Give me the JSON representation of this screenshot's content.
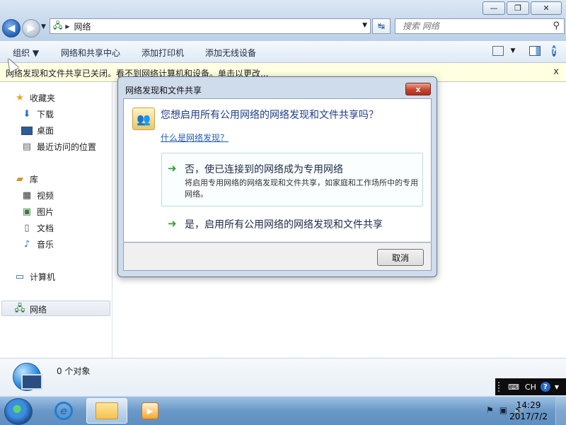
{
  "window": {
    "controls": {
      "minimize": "—",
      "restore": "❐",
      "close": "✕"
    }
  },
  "addressbar": {
    "crumb": "网络",
    "icon": "network-icon"
  },
  "search": {
    "placeholder": "搜索 网络"
  },
  "toolbar": {
    "organize": "组织 ▼",
    "network_center": "网络和共享中心",
    "add_printer": "添加打印机",
    "add_wireless": "添加无线设备",
    "help": "?"
  },
  "infobar": {
    "text": "网络发现和文件共享已关闭。看不到网络计算机和设备。单击以更改...",
    "close": "x"
  },
  "nav": {
    "favorites": "收藏夹",
    "downloads": "下载",
    "desktop": "桌面",
    "recent": "最近访问的位置",
    "libraries": "库",
    "videos": "视频",
    "pictures": "图片",
    "documents": "文档",
    "music": "音乐",
    "computer": "计算机",
    "network": "网络"
  },
  "status": {
    "count": "0 个对象"
  },
  "dialog": {
    "title": "网络发现和文件共享",
    "question": "您想启用所有公用网络的网络发现和文件共享吗？",
    "link": "什么是网络发现？",
    "option1_title": "否，使已连接到的网络成为专用网络",
    "option1_desc": "将启用专用网络的网络发现和文件共享，如家庭和工作场所中的专用网络。",
    "option2_title": "是，启用所有公用网络的网络发现和文件共享",
    "cancel": "取消",
    "close": "x"
  },
  "langbar": {
    "kb": "⌨",
    "cn": "CH"
  },
  "taskbar": {
    "time": "14:29",
    "date": "2017/7/2"
  },
  "colors": {
    "accent": "#1e3d8a",
    "link": "#1f5bb3",
    "infobar_bg": "#ffffe1",
    "close_red": "#c7452f"
  }
}
